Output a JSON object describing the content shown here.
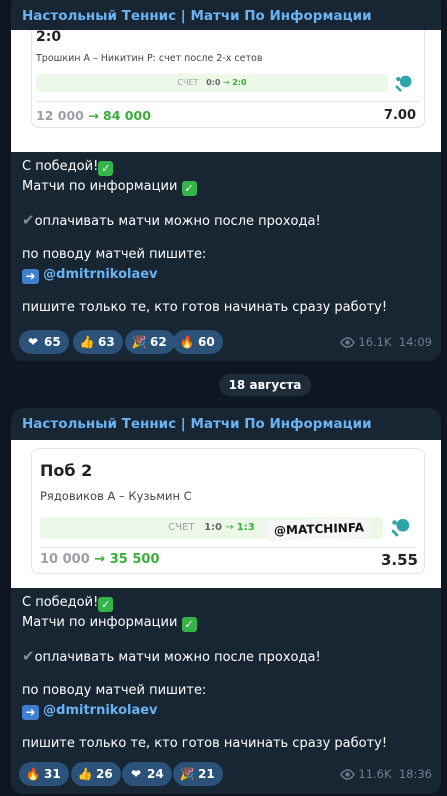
{
  "colors": {
    "background": "#0e1621",
    "bubble": "#182533",
    "channel_name": "#6ab3f3",
    "reaction_pill": "#2b5278",
    "win_green": "#3aae3a"
  },
  "messages": [
    {
      "channel": "Настольный Теннис | Матчи По Информации",
      "card": {
        "score": "2:0",
        "match": "Трошкин А – Никитин Р: счет после 2-х сетов",
        "score_label": "СЧЕТ",
        "score_from": "0:0",
        "score_to": "2:0",
        "stake": "12 000",
        "win": "84 000",
        "odds": "7.00",
        "icon": "table-tennis-icon"
      },
      "caption": {
        "line1": "С победой!",
        "line2": "Матчи по информации",
        "line3": "оплачивать матчи можно после прохода!",
        "line4": "по поводу матчей пишите:",
        "mention": "@dmitrnikolaev",
        "line5": "пишите только те, кто готов начинать сразу работу!"
      },
      "reactions": [
        {
          "emoji": "❤",
          "icon": "heart-icon",
          "count": "65"
        },
        {
          "emoji": "👍",
          "icon": "thumbs-up-icon",
          "count": "63"
        },
        {
          "emoji": "🎉",
          "icon": "party-popper-icon",
          "count": "62"
        },
        {
          "emoji": "🔥",
          "icon": "fire-icon",
          "count": "60"
        }
      ],
      "views": "16.1K",
      "time": "14:09"
    },
    {
      "channel": "Настольный Теннис | Матчи По Информации",
      "card": {
        "score": "Поб 2",
        "match": "Рядовиков А – Кузьмин С",
        "score_label": "СЧЕТ",
        "score_from": "1:0",
        "score_to": "1:3",
        "watermark": "@MATCHINFA",
        "stake": "10 000",
        "win": "35 500",
        "odds": "3.55",
        "icon": "table-tennis-icon"
      },
      "caption": {
        "line1": "С победой!",
        "line2": "Матчи по информации",
        "line3": "оплачивать матчи можно после прохода!",
        "line4": "по поводу матчей пишите:",
        "mention": "@dmitrnikolaev",
        "line5": "пишите только те, кто готов начинать сразу работу!"
      },
      "reactions": [
        {
          "emoji": "🔥",
          "icon": "fire-icon",
          "count": "31"
        },
        {
          "emoji": "👍",
          "icon": "thumbs-up-icon",
          "count": "26"
        },
        {
          "emoji": "❤",
          "icon": "heart-icon",
          "count": "24"
        },
        {
          "emoji": "🎉",
          "icon": "party-popper-icon",
          "count": "21"
        }
      ],
      "views": "11.6K",
      "time": "18:36"
    }
  ],
  "date_separator": "18 августа"
}
